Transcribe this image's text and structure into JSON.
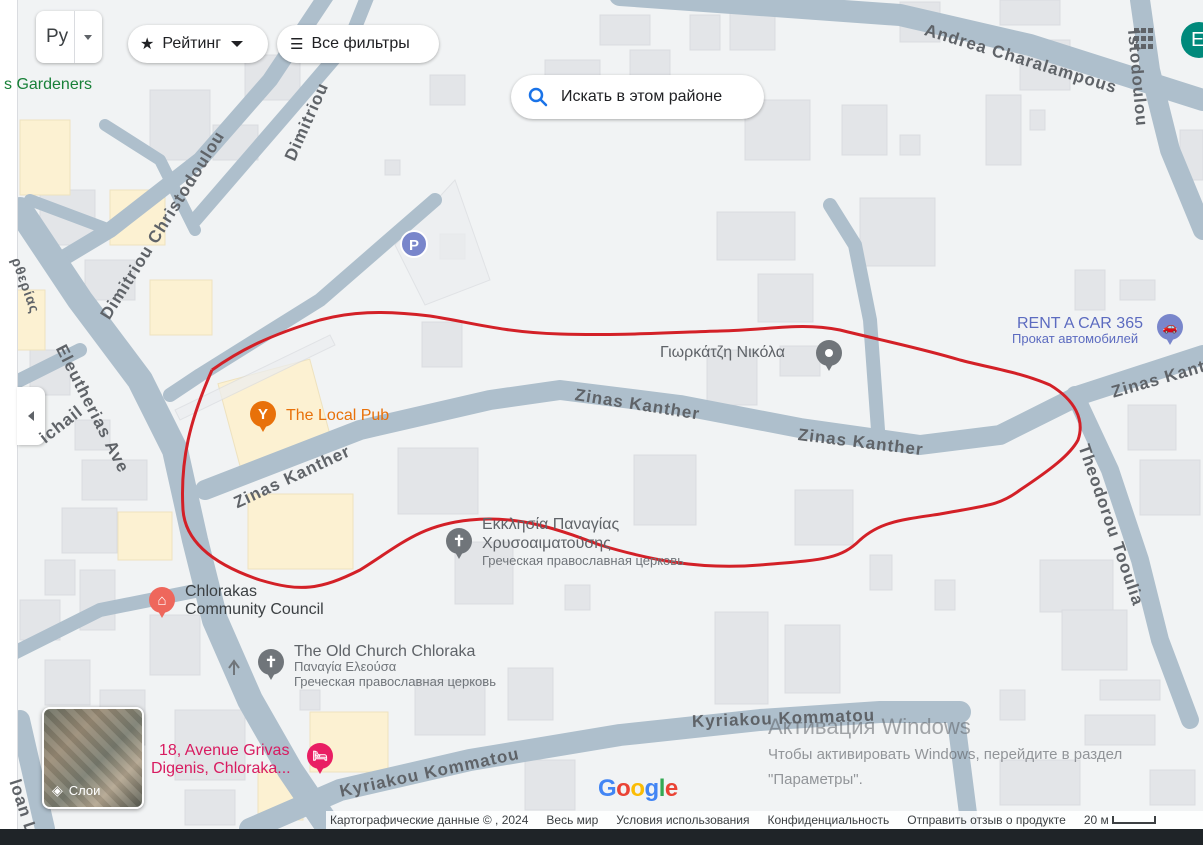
{
  "search_box": {
    "value": "Ру"
  },
  "filters": {
    "rating_label": "Рейтинг",
    "all_filters_label": "Все фильтры"
  },
  "search_area_button": "Искать в этом районе",
  "account_initial": "Е",
  "layers_label": "Слои",
  "streets": {
    "andrea": "Andrea Charalampous",
    "dimitriou1": "Dimitriou Christodoulou",
    "dimitriou2": "Dimitriou",
    "zinas1": "Zinas Kanther",
    "zinas2": "Zinas Kanther",
    "zinas3": "Zinas Kanther",
    "zinas4": "Zinas Kanther",
    "eleutherias": "Eleutherias Ave",
    "theodorou": "Theodorou Tooulia",
    "kyriakou1": "Kyriakou Kommatou",
    "kyriakou2": "Kyriakou Kommatou",
    "michail": "ichail",
    "left_partial": "ρθερίας",
    "top_partial": "isto",
    "right_partial": "istodoulou",
    "bottom_partial": "loan Li"
  },
  "places": {
    "gardeners": "s Gardeners",
    "local_pub": "The Local Pub",
    "georkatzi": "Γιωρκάτζη Νικόλα",
    "rent_a_car": "RENT A CAR 365",
    "rent_a_car_sub": "Прокат автомобилей",
    "church1_title1": "Εκκλησία Παναγίας",
    "church1_title2": "Χρυσοαιματούσης",
    "church1_sub": "Греческая православная церковь",
    "council1": "Chlorakas",
    "council2": "Community Council",
    "old_church": "The Old Church Chloraka",
    "old_church_alt": "Παναγία Ελεούσα",
    "old_church_sub": "Греческая православная церковь",
    "hotel1": "18, Avenue Grivas",
    "hotel2": "Digenis, Chloraka..."
  },
  "icons": {
    "parking": "P",
    "church": "✝",
    "pub": "Y",
    "council": "⌂",
    "car": "🚗",
    "hotel": "🛏"
  },
  "watermark": {
    "line1": "Активация Windows",
    "line2": "Чтобы активировать Windows, перейдите в раздел",
    "line3": "\"Параметры\"."
  },
  "logo": "Google",
  "footer": {
    "map_data": "Картографические данные © , 2024",
    "world": "Весь мир",
    "terms": "Условия использования",
    "privacy": "Конфиденциальность",
    "feedback": "Отправить отзыв о продукте",
    "scale": "20 м"
  },
  "colors": {
    "road": "#aebfcc",
    "background": "#f1f3f4",
    "building": "#e3e5e8",
    "highlight_building": "#fcf1d2",
    "drawn_outline": "#d32027",
    "accent_blue": "#1a73e8"
  }
}
